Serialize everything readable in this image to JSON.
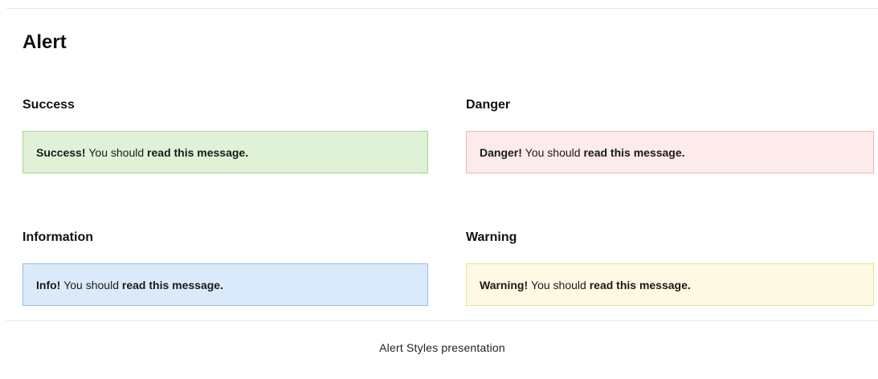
{
  "page": {
    "title": "Alert"
  },
  "sections": {
    "success": {
      "heading": "Success",
      "alert_strong": "Success!",
      "alert_text": "You should",
      "alert_emphasis": "read this message.",
      "bg_color": "#dff1d7",
      "border_color": "#a9d493"
    },
    "danger": {
      "heading": "Danger",
      "alert_strong": "Danger!",
      "alert_text": "You should",
      "alert_emphasis": "read this message.",
      "bg_color": "#fdeaea",
      "border_color": "#eab7b7"
    },
    "info": {
      "heading": "Information",
      "alert_strong": "Info!",
      "alert_text": "You should",
      "alert_emphasis": "read this message.",
      "bg_color": "#dbeafb",
      "border_color": "#93c0e3"
    },
    "warning": {
      "heading": "Warning",
      "alert_strong": "Warning!",
      "alert_text": "You should",
      "alert_emphasis": "read this message.",
      "bg_color": "#fdf9e2",
      "border_color": "#ecdf94"
    }
  },
  "caption": "Alert Styles presentation"
}
